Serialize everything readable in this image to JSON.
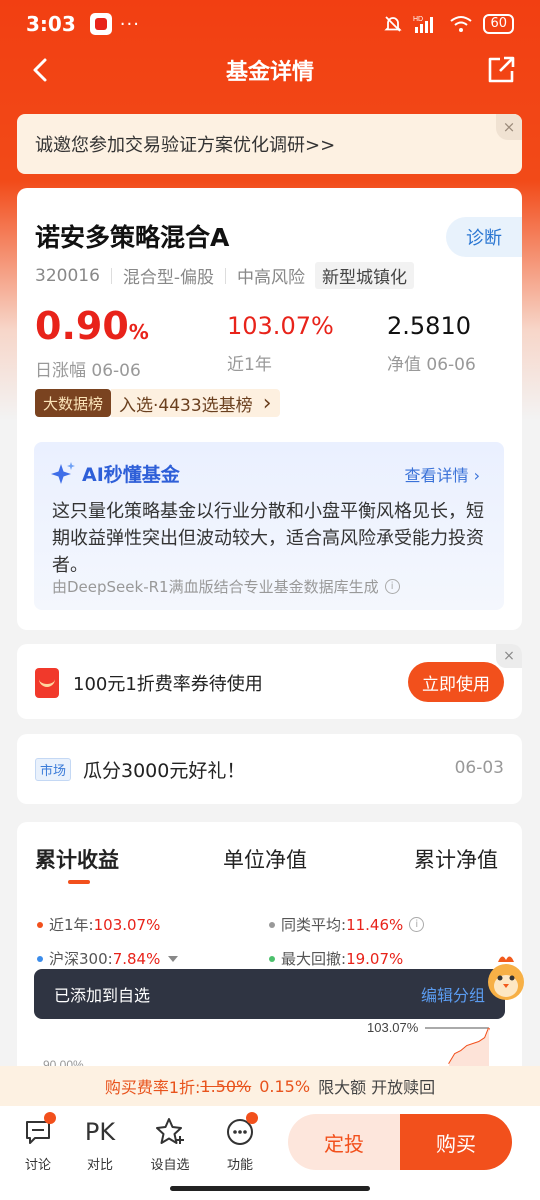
{
  "status_bar": {
    "time": "3:03",
    "dots": "···",
    "battery": "60",
    "hd": "HD"
  },
  "header": {
    "title": "基金详情"
  },
  "survey": {
    "text": "诚邀您参加交易验证方案优化调研>>",
    "close": "×"
  },
  "fund": {
    "name": "诺安多策略混合A",
    "diagnose_label": "诊断",
    "code": "320016",
    "type": "混合型-偏股",
    "risk": "中高风险",
    "theme": "新型城镇化",
    "daily_change": "0.90",
    "daily_change_unit": "%",
    "daily_label": "日涨幅 06-06",
    "year_return": "103.07%",
    "year_label": "近1年",
    "nav_value": "2.5810",
    "nav_label": "净值 06-06",
    "rank_badge": "大数据榜",
    "rank_text": "入选·4433选基榜",
    "rank_arrow": "›"
  },
  "ai": {
    "title": "AI秒懂基金",
    "more": "查看详情 ›",
    "description": "这只量化策略基金以行业分散和小盘平衡风格见长，短期收益弹性突出但波动较大，适合高风险承受能力投资者。",
    "source": "由DeepSeek-R1满血版结合专业基金数据库生成",
    "info": "i"
  },
  "coupon": {
    "text": "100元1折费率券待使用",
    "button": "立即使用",
    "close": "×"
  },
  "news": {
    "tag": "市场",
    "title": "瓜分3000元好礼！",
    "date": "06-03"
  },
  "chart_tabs": [
    "累计收益",
    "单位净值",
    "累计净值"
  ],
  "legend": {
    "near1y_label": "近1年:",
    "near1y_value": "103.07%",
    "peer_label": "同类平均:",
    "peer_value": "11.46%",
    "hs300_label": "沪深300:",
    "hs300_value": "7.84%",
    "drawdown_label": "最大回撤:",
    "drawdown_value": "19.07%",
    "colors": {
      "near1y": "#f2501c",
      "peer": "#999999",
      "hs300": "#3b8cea",
      "drawdown": "#4cc06c"
    }
  },
  "chart_labels": {
    "end_value": "103.07%",
    "left_axis": "90.00%"
  },
  "toast": {
    "text": "已添加到自选",
    "action": "编辑分组"
  },
  "fee_bar": {
    "prefix": "购买费率1折:",
    "old_rate": "1.50%",
    "new_rate": "0.15%",
    "suffix": "限大额 开放赎回"
  },
  "bottom_nav": {
    "discuss": "讨论",
    "pk_icon": "PK",
    "compare": "对比",
    "watchlist": "设自选",
    "functions": "功能",
    "dingtou": "定投",
    "buy": "购买"
  }
}
